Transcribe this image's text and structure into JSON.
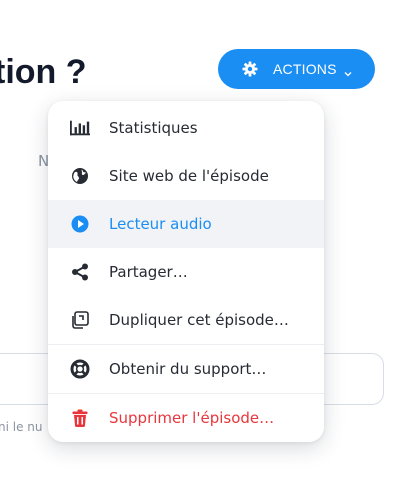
{
  "page": {
    "title": "tion ?",
    "bg_text_n": "N",
    "bg_hint": "ni le nu"
  },
  "actions": {
    "label": "ACTIONS",
    "icon": "gear-icon",
    "color": "#1b8ef3"
  },
  "menu": {
    "items": [
      {
        "label": "Statistiques",
        "icon": "bar-chart-icon"
      },
      {
        "label": "Site web de l'épisode",
        "icon": "globe-icon"
      },
      {
        "label": "Lecteur audio",
        "icon": "play-icon",
        "active": true,
        "color": "#1b8ef3"
      },
      {
        "label": "Partager…",
        "icon": "share-icon"
      },
      {
        "label": "Dupliquer cet épisode…",
        "icon": "duplicate-icon"
      },
      {
        "label": "Obtenir du support…",
        "icon": "lifebuoy-icon"
      },
      {
        "label": "Supprimer l'épisode…",
        "icon": "trash-icon",
        "color": "#e8363d"
      }
    ]
  }
}
